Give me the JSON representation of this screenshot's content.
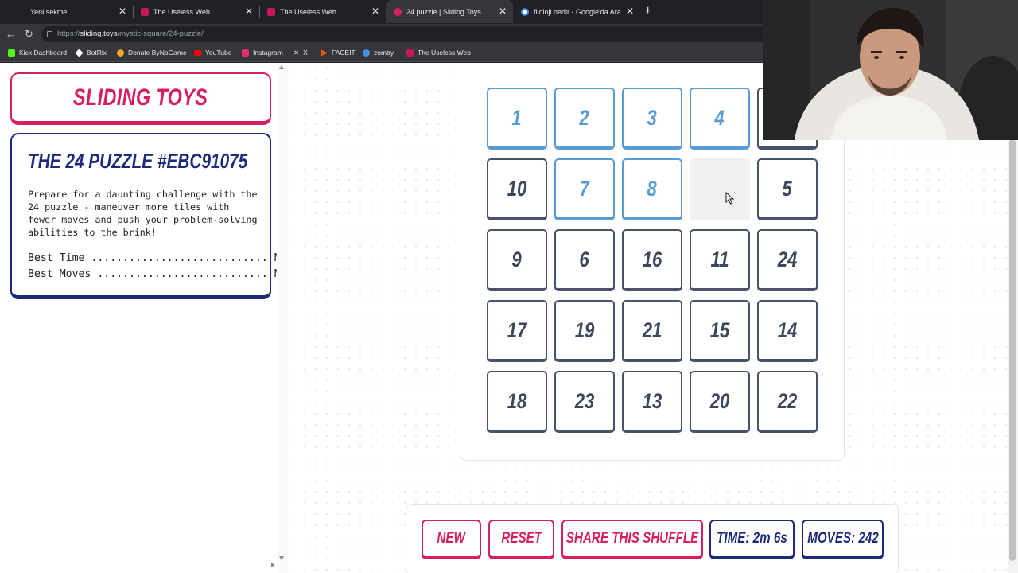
{
  "browser": {
    "tabs": [
      {
        "title": "Yeni sekme",
        "favicon_color": "#202124",
        "active": false
      },
      {
        "title": "The Useless Web",
        "favicon_color": "#c2185b",
        "active": false
      },
      {
        "title": "The Useless Web",
        "favicon_color": "#c2185b",
        "active": false
      },
      {
        "title": "24 puzzle | Sliding Toys",
        "favicon_color": "#d81f5d",
        "active": true
      },
      {
        "title": "filoloji nedir - Google'da Ara",
        "favicon_color": "#4285f4",
        "active": false
      }
    ],
    "new_tab_label": "+",
    "close_glyph": "✕",
    "url_scheme": "https://",
    "url_host": "sliding.toys",
    "url_path": "/mystic-square/24-puzzle/",
    "bookmarks": [
      {
        "label": "Kick Dashboard",
        "icon_color": "#53fc18",
        "icon": "kick-icon"
      },
      {
        "label": "BotRix",
        "icon_color": "#ffffff",
        "icon": "botrix-icon"
      },
      {
        "label": "Donate ByNoGame",
        "icon_color": "#f5a623",
        "icon": "bynogame-icon"
      },
      {
        "label": "YouTube",
        "icon_color": "#ff0000",
        "icon": "youtube-icon"
      },
      {
        "label": "Instagram",
        "icon_color": "#e1306c",
        "icon": "instagram-icon"
      },
      {
        "label": "X",
        "icon_color": "#ffffff",
        "icon": "x-icon"
      },
      {
        "label": "FACEIT",
        "icon_color": "#ff5500",
        "icon": "faceit-icon"
      },
      {
        "label": "zomby",
        "icon_color": "#4a90e2",
        "icon": "zomby-icon"
      },
      {
        "label": "The Useless Web",
        "icon_color": "#c2185b",
        "icon": "useless-web-icon"
      }
    ]
  },
  "sidebar": {
    "logo": "SLIDING TOYS",
    "puzzle_title": "THE 24 PUZZLE #EBC91075",
    "description": "Prepare for a daunting challenge with the 24 puzzle - maneuver more tiles with fewer moves and push your problem-solving abilities to the brink!",
    "best_time_line": "Best Time ............................ N/A",
    "best_moves_line": "Best Moves ........................... N/A"
  },
  "board": {
    "tiles": [
      "1",
      "2",
      "3",
      "4",
      "",
      "10",
      "7",
      "8",
      "",
      "5",
      "9",
      "6",
      "16",
      "11",
      "24",
      "17",
      "19",
      "21",
      "15",
      "14",
      "18",
      "23",
      "13",
      "20",
      "22"
    ],
    "correct_tiles": [
      "1",
      "2",
      "3",
      "4",
      "7",
      "8"
    ],
    "accent_pink": "#d81f5d",
    "accent_navy": "#1b2a7a",
    "accent_blue": "#5b9bd5"
  },
  "controls": {
    "new_label": "NEW",
    "reset_label": "RESET",
    "share_label": "SHARE THIS SHUFFLE",
    "time_label": "TIME: 2m 6s",
    "moves_label": "MOVES: 242"
  }
}
